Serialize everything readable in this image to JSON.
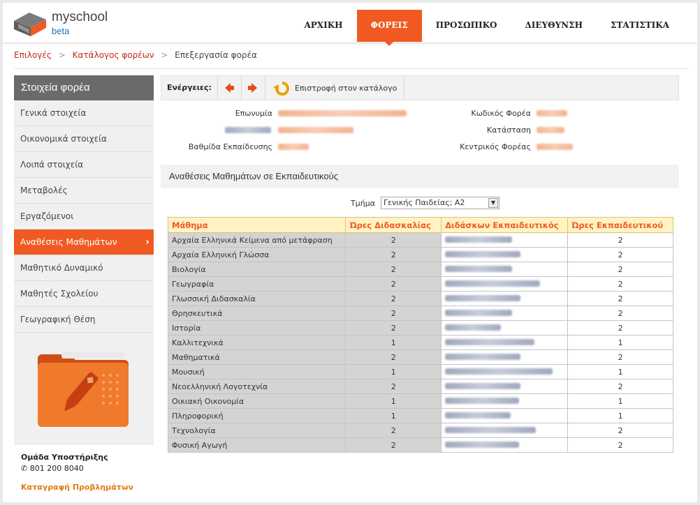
{
  "header": {
    "logo_name": "myschool",
    "logo_sub": "beta",
    "nav": [
      {
        "label": "ΑΡΧΙΚΗ",
        "active": false
      },
      {
        "label": "ΦΟΡΕΙΣ",
        "active": true
      },
      {
        "label": "ΠΡΟΣΩΠΙΚΟ",
        "active": false
      },
      {
        "label": "ΔΙΕΥΘΥΝΣΗ",
        "active": false
      },
      {
        "label": "ΣΤΑΤΙΣΤΙΚΑ",
        "active": false
      }
    ]
  },
  "breadcrumb": [
    "Επιλογές",
    "Κατάλογος φορέων",
    "Επεξεργασία φορέα"
  ],
  "sidebar": {
    "title": "Στοιχεία φορέα",
    "items": [
      {
        "label": "Γενικά στοιχεία",
        "active": false
      },
      {
        "label": "Οικονομικά στοιχεία",
        "active": false
      },
      {
        "label": "Λοιπά στοιχεία",
        "active": false
      },
      {
        "label": "Μεταβολές",
        "active": false
      },
      {
        "label": "Εργαζόμενοι",
        "active": false
      },
      {
        "label": "Αναθέσεις Μαθημάτων",
        "active": true
      },
      {
        "label": "Μαθητικό Δυναμικό",
        "active": false
      },
      {
        "label": "Μαθητές Σχολείου",
        "active": false
      },
      {
        "label": "Γεωγραφική Θέση",
        "active": false
      }
    ],
    "support_title": "Ομάδα Υποστήριξης",
    "support_phone": "801 200 8040",
    "support_link": "Καταγραφή Προβλημάτων"
  },
  "toolbar": {
    "label": "Ενέργειες:",
    "return_label": "Επιστροφή στον κατάλογο"
  },
  "info": {
    "name_label": "Επωνυμία",
    "level_label": "Βαθμίδα Εκπαίδευσης",
    "code_label": "Κωδικός Φορέα",
    "status_label": "Κατάσταση",
    "central_label": "Κεντρικός Φορέας"
  },
  "section_title": "Αναθέσεις Μαθημάτων σε Εκπαιδευτικούς",
  "filter": {
    "label": "Τμήμα",
    "value": "Γενικής Παιδείας; Α2"
  },
  "table": {
    "headers": [
      "Μάθημα",
      "Ώρες Διδασκαλίας",
      "Διδάσκων Εκπαιδευτικός",
      "Ώρες Εκπαιδευτικού"
    ],
    "rows": [
      {
        "course": "Αρχαία Ελληνικά Κείμενα από μετάφραση",
        "hours": "2",
        "teacher_hours": "2"
      },
      {
        "course": "Αρχαία Ελληνική Γλώσσα",
        "hours": "2",
        "teacher_hours": "2"
      },
      {
        "course": "Βιολογία",
        "hours": "2",
        "teacher_hours": "2"
      },
      {
        "course": "Γεωγραφία",
        "hours": "2",
        "teacher_hours": "2"
      },
      {
        "course": "Γλωσσική Διδασκαλία",
        "hours": "2",
        "teacher_hours": "2"
      },
      {
        "course": "Θρησκευτικά",
        "hours": "2",
        "teacher_hours": "2"
      },
      {
        "course": "Ιστορία",
        "hours": "2",
        "teacher_hours": "2"
      },
      {
        "course": "Καλλιτεχνικά",
        "hours": "1",
        "teacher_hours": "1"
      },
      {
        "course": "Μαθηματικά",
        "hours": "2",
        "teacher_hours": "2"
      },
      {
        "course": "Μουσική",
        "hours": "1",
        "teacher_hours": "1"
      },
      {
        "course": "Νεοελληνική Λογοτεχνία",
        "hours": "2",
        "teacher_hours": "2"
      },
      {
        "course": "Οικιακή Οικονομία",
        "hours": "1",
        "teacher_hours": "1"
      },
      {
        "course": "Πληροφορική",
        "hours": "1",
        "teacher_hours": "1"
      },
      {
        "course": "Τεχνολογία",
        "hours": "2",
        "teacher_hours": "2"
      },
      {
        "course": "Φυσική Αγωγή",
        "hours": "2",
        "teacher_hours": "2"
      }
    ]
  }
}
